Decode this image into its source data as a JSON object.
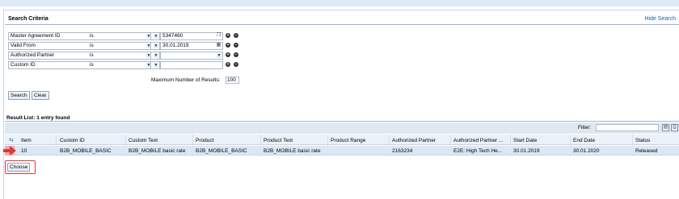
{
  "search_panel": {
    "title": "Search Criteria",
    "hide_link": "Hide Search"
  },
  "criteria": [
    {
      "field": "Master Agreement ID",
      "operator": "is",
      "value": "5347460"
    },
    {
      "field": "Valid From",
      "operator": "is",
      "value": "30.01.2019"
    },
    {
      "field": "Authorized Partner",
      "operator": "is",
      "value": ""
    },
    {
      "field": "Custom ID",
      "operator": "is",
      "value": ""
    }
  ],
  "max_results": {
    "label": "Maximum Number of Results:",
    "value": "100"
  },
  "buttons": {
    "search": "Search",
    "clear": "Clear",
    "choose": "Choose"
  },
  "results": {
    "title": "Result List: 1 entry found",
    "filter_label": "Filter:",
    "columns": [
      "Item",
      "Custom ID",
      "Custom Text",
      "Product",
      "Product Text",
      "Product Range",
      "Authorized Partner",
      "Authorized Partner ...",
      "Start Date",
      "End Date",
      "Status"
    ],
    "rows": [
      {
        "item": "10",
        "custom_id": "B2B_MOBILE_BASIC",
        "custom_text": "B2B_MOBILE basic rate",
        "product": "B2B_MOBILE_BASIC",
        "product_text": "B2B_MOBILE basic rate",
        "product_range": "",
        "authorized_partner": "2163234",
        "authorized_partner_name": "E2E: High Tech He...",
        "start_date": "30.01.2019",
        "end_date": "30.01.2020",
        "status": "Released"
      }
    ]
  },
  "colors": {
    "header_bg": "#dfe8f1",
    "selected_row": "#dbe7f3",
    "highlight": "#d93a3a",
    "link": "#1f5ea8"
  }
}
